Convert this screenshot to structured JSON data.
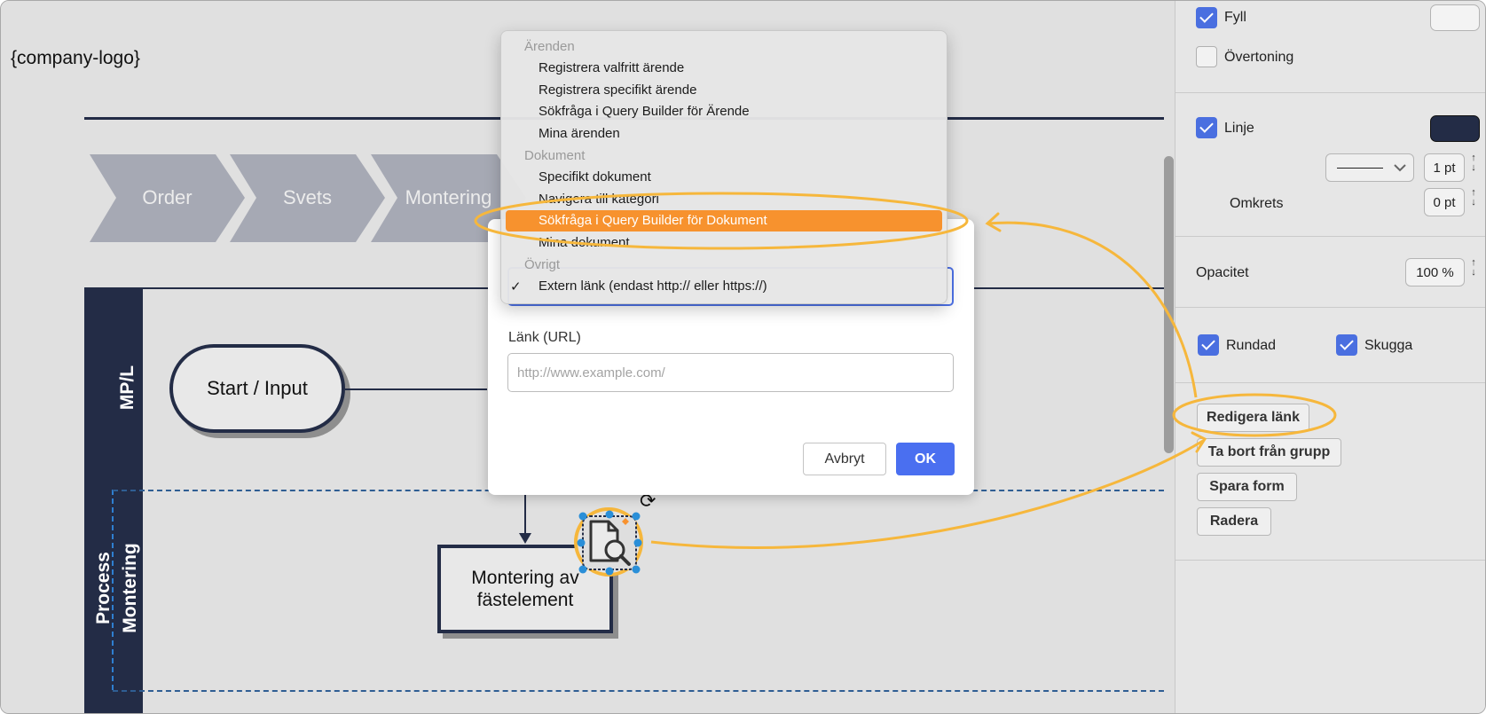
{
  "logo": {
    "text": "{company-logo}"
  },
  "process": {
    "steps": [
      "Order",
      "Svets",
      "Montering"
    ]
  },
  "lanes": {
    "mpl": "MP/L",
    "process": "Process",
    "montering": "Montering"
  },
  "shapes": {
    "start": "Start / Input",
    "box_line1": "Montering av",
    "box_line2": "fästelement"
  },
  "menu": {
    "groups": [
      {
        "label": "Ärenden",
        "items": [
          "Registrera valfritt ärende",
          "Registrera specifikt ärende",
          "Sökfråga i Query Builder för Ärende",
          "Mina ärenden"
        ]
      },
      {
        "label": "Dokument",
        "items": [
          "Specifikt dokument",
          "Navigera till kategori",
          "Sökfråga i Query Builder för Dokument",
          "Mina dokument"
        ]
      },
      {
        "label": "Övrigt",
        "items": [
          "Extern länk (endast http:// eller https://)"
        ]
      }
    ],
    "highlighted": "Sökfråga i Query Builder för Dokument",
    "checked": "Extern länk (endast http:// eller https://)",
    "check_mark": "✓"
  },
  "dialog": {
    "url_label": "Länk (URL)",
    "url_placeholder": "http://www.example.com/",
    "cancel": "Avbryt",
    "ok": "OK"
  },
  "panel": {
    "fill": {
      "label": "Fyll",
      "checked": true,
      "color": "#f3f3f3"
    },
    "gradient": {
      "label": "Övertoning",
      "checked": false
    },
    "line": {
      "label": "Linje",
      "checked": true,
      "color": "#232c46",
      "width": "1 pt"
    },
    "perimeter": {
      "label": "Omkrets",
      "value": "0 pt"
    },
    "opacity": {
      "label": "Opacitet",
      "value": "100 %"
    },
    "rounded": {
      "label": "Rundad",
      "checked": true
    },
    "shadow": {
      "label": "Skugga",
      "checked": true
    },
    "buttons": {
      "edit_link": "Redigera länk",
      "remove_group": "Ta bort från grupp",
      "save_shape": "Spara form",
      "delete": "Radera"
    },
    "spin_glyph": "↑↓"
  },
  "colors": {
    "accent": "#4a6fe0",
    "highlight": "#f7922e",
    "annotation": "#f6b73c",
    "navy": "#232c46"
  }
}
